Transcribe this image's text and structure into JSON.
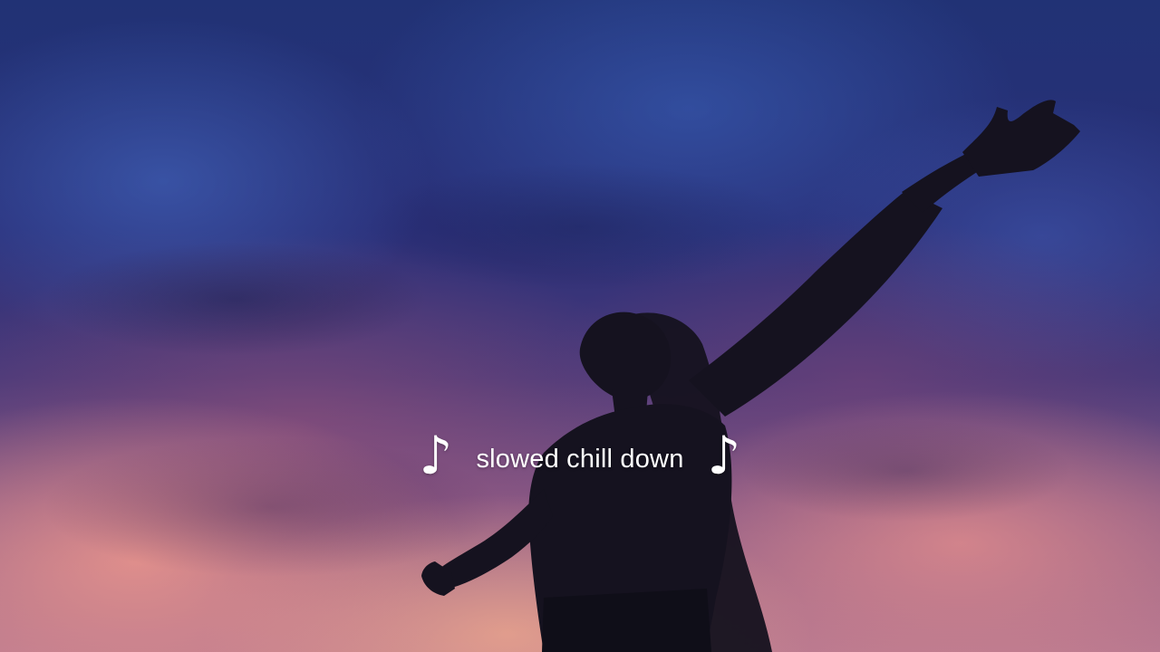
{
  "video": {
    "caption_text": "slowed chill down",
    "left_note": "♪",
    "right_note": "♪"
  },
  "colors": {
    "sky_top": "#213275",
    "sky_horizon": "#b77890",
    "silhouette": "#15121f",
    "caption": "#ffffff"
  }
}
